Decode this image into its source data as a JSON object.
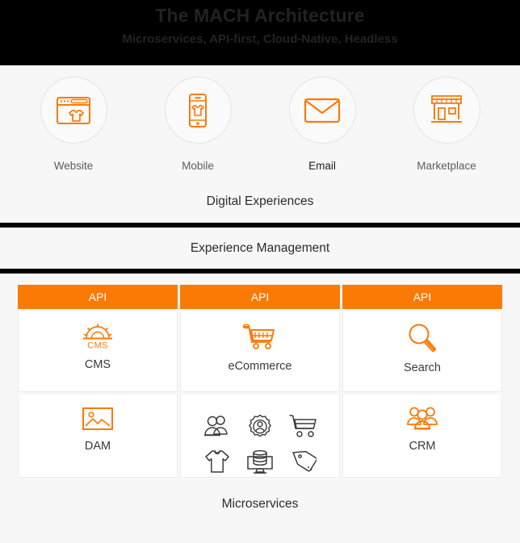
{
  "header": {
    "title": "The MACH Architecture",
    "subtitle": "Microservices, API-first, Cloud-Native, Headless",
    "background_color": "#000000",
    "title_color": "#222222"
  },
  "accent_color": "#fb7a06",
  "digital_experiences": {
    "caption": "Digital Experiences",
    "items": [
      {
        "label": "Website",
        "icon": "browser-window-tshirt-icon",
        "active": false
      },
      {
        "label": "Mobile",
        "icon": "mobile-phone-tshirt-icon",
        "active": false
      },
      {
        "label": "Email",
        "icon": "envelope-icon",
        "active": true
      },
      {
        "label": "Marketplace",
        "icon": "storefront-icon",
        "active": false
      }
    ]
  },
  "experience_management": {
    "caption": "Experience Management"
  },
  "columns": [
    {
      "api_label": "API",
      "primary": {
        "label": "CMS",
        "icon": "cms-gear-icon"
      },
      "secondary": {
        "label": "DAM",
        "icon": "image-picture-icon"
      }
    },
    {
      "api_label": "API",
      "primary": {
        "label": "eCommerce",
        "icon": "shopping-cart-icon"
      },
      "microservices": [
        {
          "icon": "two-people-icon"
        },
        {
          "icon": "gear-person-icon"
        },
        {
          "icon": "shopping-cart-outline-icon"
        },
        {
          "icon": "tshirt-icon"
        },
        {
          "icon": "database-monitor-icon"
        },
        {
          "icon": "price-tag-icon"
        }
      ]
    },
    {
      "api_label": "API",
      "primary": {
        "label": "Search",
        "icon": "magnifier-icon"
      },
      "secondary": {
        "label": "CRM",
        "icon": "people-group-icon"
      }
    }
  ],
  "footer": {
    "caption": "Microservices"
  }
}
